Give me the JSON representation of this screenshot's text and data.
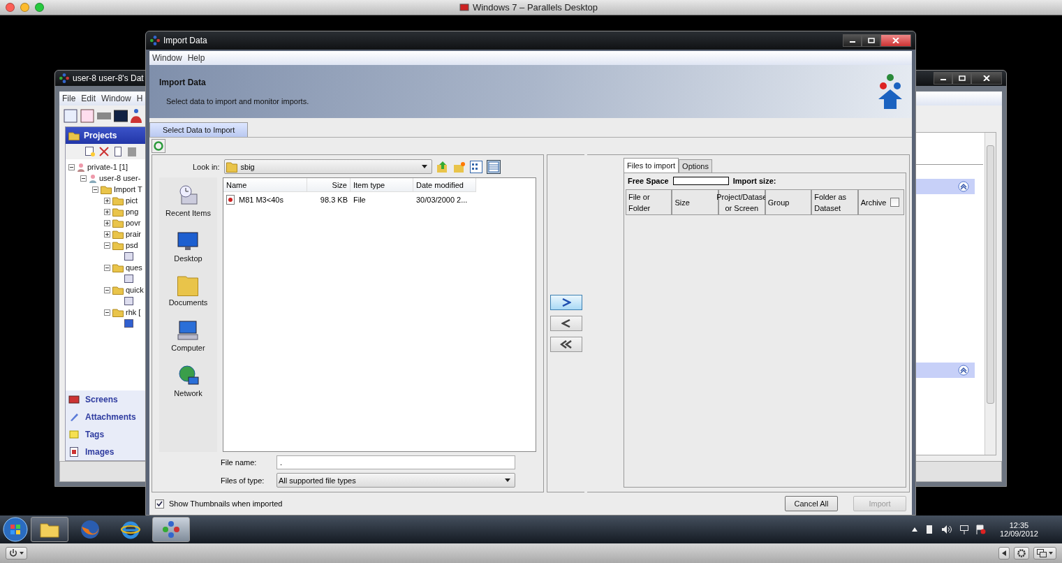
{
  "host_window": {
    "title": "Windows 7 – Parallels Desktop"
  },
  "background_window": {
    "title": "user-8 user-8's Dat",
    "menu": [
      "File",
      "Edit",
      "Window",
      "H"
    ],
    "projects_title": "Projects",
    "tree": [
      {
        "label": "private-1 [1]",
        "expanded": true,
        "children": [
          {
            "label": "user-8 user-",
            "expanded": true,
            "children": [
              {
                "label": "Import T",
                "expanded": true,
                "children": [
                  {
                    "label": "pict",
                    "expanded": false
                  },
                  {
                    "label": "png",
                    "expanded": false
                  },
                  {
                    "label": "povr",
                    "expanded": false
                  },
                  {
                    "label": "prair",
                    "expanded": false
                  },
                  {
                    "label": "psd",
                    "expanded": true,
                    "children": [
                      {
                        "selected": false
                      }
                    ]
                  },
                  {
                    "label": "ques",
                    "expanded": true,
                    "children": [
                      {
                        "selected": false
                      }
                    ]
                  },
                  {
                    "label": "quick",
                    "expanded": true,
                    "children": [
                      {
                        "selected": false
                      }
                    ]
                  },
                  {
                    "label": "rhk [",
                    "expanded": true,
                    "children": [
                      {
                        "selected": true
                      }
                    ]
                  }
                ]
              }
            ]
          }
        ]
      }
    ],
    "nav": [
      {
        "kind": "screens",
        "label": "Screens"
      },
      {
        "kind": "attachments",
        "label": "Attachments"
      },
      {
        "kind": "tags",
        "label": "Tags"
      },
      {
        "kind": "images",
        "label": "Images"
      }
    ]
  },
  "dialog": {
    "title": "Import Data",
    "menu": [
      "Window",
      "Help"
    ],
    "banner": {
      "title": "Import Data",
      "subtitle": "Select data to import and monitor imports."
    },
    "tabs": [
      {
        "label": "Select Data to Import",
        "selected": true
      }
    ],
    "chooser": {
      "look_in_label": "Look in:",
      "look_in": "sbig",
      "places": [
        {
          "kind": "recent",
          "label": "Recent Items"
        },
        {
          "kind": "desktop",
          "label": "Desktop"
        },
        {
          "kind": "documents",
          "label": "Documents"
        },
        {
          "kind": "computer",
          "label": "Computer"
        },
        {
          "kind": "network",
          "label": "Network"
        }
      ],
      "columns": [
        "Name",
        "Size",
        "Item type",
        "Date modified"
      ],
      "rows": [
        {
          "name": "M81 M3<40s",
          "size": "98.3 KB",
          "type": "File",
          "modified": "30/03/2000 2..."
        }
      ],
      "file_name_label": "File name:",
      "file_name": ".",
      "file_type_label": "Files of type:",
      "file_type": "All supported file types"
    },
    "transfer_buttons": [
      {
        "kind": "add",
        "selected": true
      },
      {
        "kind": "remove",
        "selected": false
      },
      {
        "kind": "remove_all",
        "selected": false
      }
    ],
    "queue": {
      "tabs": [
        {
          "label": "Files to import",
          "selected": true
        },
        {
          "label": "Options",
          "selected": false
        }
      ],
      "free_space_label": "Free Space",
      "free_space": {
        "level": 0
      },
      "import_size_label": "Import size:",
      "columns": [
        {
          "label": "File or\nFolder",
          "kind": "text"
        },
        {
          "label": "Size",
          "kind": "text"
        },
        {
          "label": "Project/Datase\nor Screen",
          "kind": "text"
        },
        {
          "label": "Group",
          "kind": "text"
        },
        {
          "label": "Folder as\nDataset",
          "kind": "text"
        },
        {
          "label": "Archive",
          "kind": "checkbox",
          "checked": false
        }
      ]
    },
    "show_thumbnails": {
      "label": "Show Thumbnails when imported",
      "checked": true
    },
    "buttons": [
      {
        "label": "Cancel All",
        "disabled": false
      },
      {
        "label": "Import",
        "disabled": true
      }
    ]
  },
  "taskbar": {
    "apps": [
      {
        "kind": "explorer",
        "running": true,
        "selected": false
      },
      {
        "kind": "firefox",
        "running": false,
        "selected": false
      },
      {
        "kind": "ie",
        "running": false,
        "selected": false
      },
      {
        "kind": "omero",
        "running": true,
        "selected": true
      }
    ],
    "time": "12:35",
    "date": "12/09/2012"
  }
}
